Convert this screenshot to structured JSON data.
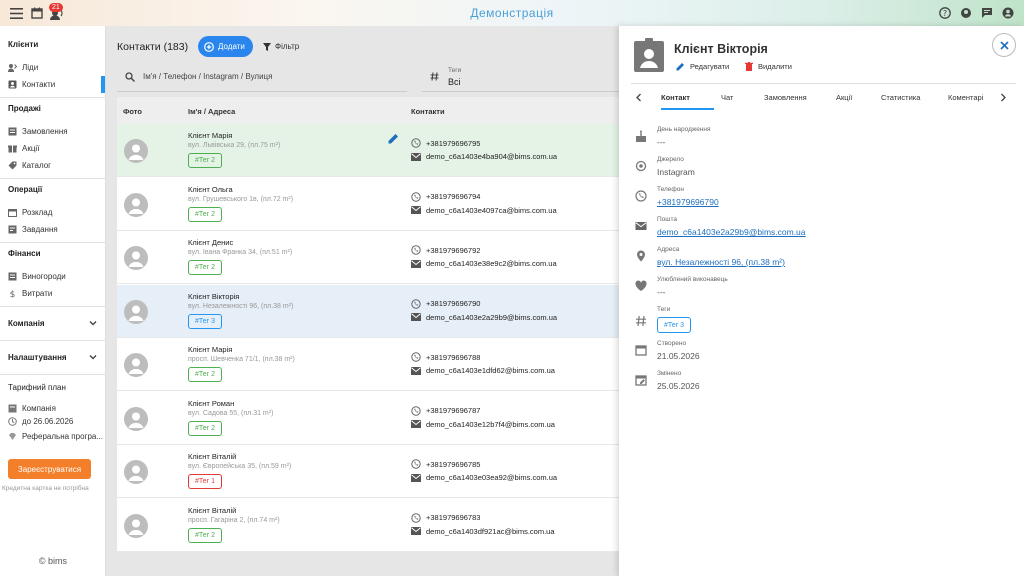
{
  "topbar": {
    "title": "Демонстрація",
    "notif_count": "21"
  },
  "sidebar": {
    "sections": [
      {
        "title": "Клієнти",
        "items": [
          {
            "label": "Ліди"
          },
          {
            "label": "Контакти"
          }
        ]
      },
      {
        "title": "Продажі",
        "items": [
          {
            "label": "Замовлення"
          },
          {
            "label": "Акції"
          },
          {
            "label": "Каталог"
          }
        ]
      },
      {
        "title": "Операції",
        "items": [
          {
            "label": "Розклад"
          },
          {
            "label": "Завдання"
          }
        ]
      },
      {
        "title": "Фінанси",
        "items": [
          {
            "label": "Виногороди"
          },
          {
            "label": "Витрати"
          }
        ]
      }
    ],
    "company": "Компанія",
    "settings": "Налаштування",
    "plan_title": "Тарифний план",
    "plan_items": [
      {
        "label": "Компанія"
      },
      {
        "label": "до 26.06.2026"
      },
      {
        "label": "Реферальна програ..."
      }
    ],
    "register_label": "Зареєструватися",
    "note": "Кредитна картка не потрібна",
    "brand": "© bims"
  },
  "main": {
    "title": "Контакти (183)",
    "add_label": "Додати",
    "filter_label": "Фільтр",
    "search_placeholder": "Ім'я / Телефон / Instagram / Вулиця",
    "tags_label": "Теги",
    "tags_value": "Всі",
    "columns": {
      "photo": "Фото",
      "name": "Ім'я / Адреса",
      "contacts": "Контакти"
    },
    "rows": [
      {
        "name": "Клієнт Марія",
        "address": "вул. Львівська 29, (пл.75 m²)",
        "tag": "#Тег 2",
        "phone": "+381979696795",
        "email": "demo_c6a1403e4ba904@bims.com.ua"
      },
      {
        "name": "Клієнт Ольга",
        "address": "вул. Грушевського 1в, (пл.72 m²)",
        "tag": "#Тег 2",
        "phone": "+381979696794",
        "email": "demo_c6a1403e4097ca@bims.com.ua"
      },
      {
        "name": "Клієнт Денис",
        "address": "вул. Івана Франка 34, (пл.51 m²)",
        "tag": "#Тег 2",
        "phone": "+381979696792",
        "email": "demo_c6a1403e38e9c2@bims.com.ua"
      },
      {
        "name": "Клієнт Вікторія",
        "address": "вул. Незалежності 96, (пл.38 m²)",
        "tag": "#Тег 3",
        "phone": "+381979696790",
        "email": "demo_c6a1403e2a29b9@bims.com.ua"
      },
      {
        "name": "Клієнт Марія",
        "address": "просп. Шевченка 71/1, (пл.38 m²)",
        "tag": "#Тег 2",
        "phone": "+381979696788",
        "email": "demo_c6a1403e1dfd62@bims.com.ua"
      },
      {
        "name": "Клієнт Роман",
        "address": "вул. Садова 55, (пл.31 m²)",
        "tag": "#Тег 2",
        "phone": "+381979696787",
        "email": "demo_c6a1403e12b7f4@bims.com.ua"
      },
      {
        "name": "Клієнт Віталій",
        "address": "вул. Європейська 35, (пл.59 m²)",
        "tag": "#Тег 1",
        "phone": "+381979696785",
        "email": "demo_c6a1403e03ea92@bims.com.ua"
      },
      {
        "name": "Клієнт Віталій",
        "address": "просп. Гагаріна 2, (пл.74 m²)",
        "tag": "#Тег 2",
        "phone": "+381979696783",
        "email": "demo_c6a1403df921ac@bims.com.ua"
      }
    ]
  },
  "panel": {
    "title": "Клієнт Вікторія",
    "edit_label": "Редагувати",
    "delete_label": "Видалити",
    "tabs": [
      {
        "label": "Контакт"
      },
      {
        "label": "Чат"
      },
      {
        "label": "Замовлення"
      },
      {
        "label": "Акції"
      },
      {
        "label": "Статистика"
      },
      {
        "label": "Коментарі"
      }
    ],
    "fields": {
      "birthday": {
        "label": "День народження",
        "value": "---"
      },
      "source": {
        "label": "Джерело",
        "value": "Instagram"
      },
      "phone": {
        "label": "Телефон",
        "value": "+381979696790"
      },
      "email": {
        "label": "Пошта",
        "value": "demo_c6a1403e2a29b9@bims.com.ua"
      },
      "address": {
        "label": "Адреса",
        "value": "вул. Незалежності 96, (пл.38 m²)"
      },
      "artist": {
        "label": "Улюблений виконавець",
        "value": "---"
      },
      "tags": {
        "label": "Теги",
        "value": "#Тег 3"
      },
      "created": {
        "label": "Створено",
        "value": "21.05.2026"
      },
      "modified": {
        "label": "Змінено",
        "value": "25.05.2026"
      }
    }
  },
  "colors": {
    "accent": "#2196f3",
    "register": "#f47f2a",
    "tag_green": "#4caf50",
    "tag_red": "#e53935",
    "row_selected_green": "#e5f3e6",
    "row_selected_blue": "#e6eef7"
  }
}
